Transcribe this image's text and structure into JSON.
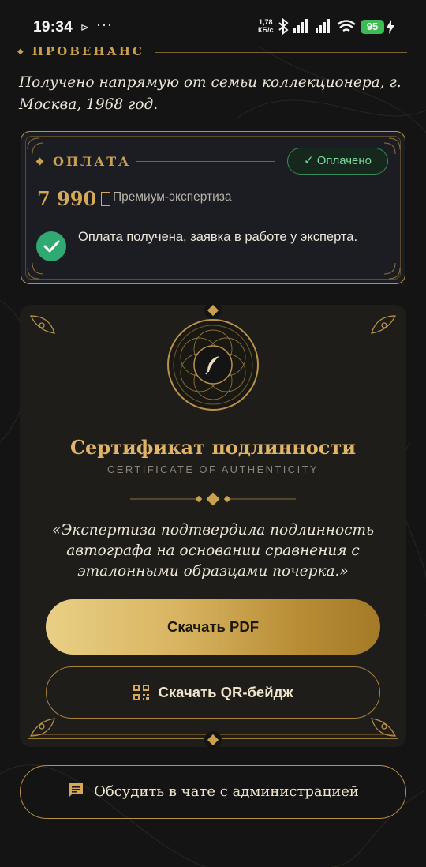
{
  "status_bar": {
    "time": "19:34",
    "nav_glyph": "⊳",
    "overflow": "···",
    "net_speed_value": "1,78",
    "net_speed_unit": "КБ/с",
    "battery": "95",
    "icons": [
      "bluetooth-icon",
      "signal-icon",
      "signal-icon",
      "wifi-icon",
      "battery-icon",
      "charging-icon"
    ]
  },
  "provenance": {
    "heading": "ПРОВЕНАНС",
    "text": "Получено напрямую от семьи коллекционера, г. Москва, 1968 год."
  },
  "payment": {
    "title": "ОПЛАТА",
    "status_label": "✓ Оплачено",
    "price": "7 990",
    "tier": "Премиум-экспертиза",
    "note": "Оплата получена, заявка в работе у эксперта."
  },
  "certificate": {
    "title": "Сертификат подлинности",
    "subtitle": "CERTIFICATE OF AUTHENTICITY",
    "quote": "«Экспертиза подтвердила подлинность автографа на основании сравнения с эталонными образцами почерка.»",
    "download_pdf_label": "Скачать PDF",
    "download_qr_label": "Скачать QR-бейдж",
    "seal_icon": "quill-icon"
  },
  "chat_button": {
    "label": "Обсудить в чате с администрацией",
    "icon": "chat-icon"
  },
  "colors": {
    "gold": "#c9a04e",
    "background": "#141414",
    "card": "#1b1d22",
    "success": "#2faa73"
  }
}
